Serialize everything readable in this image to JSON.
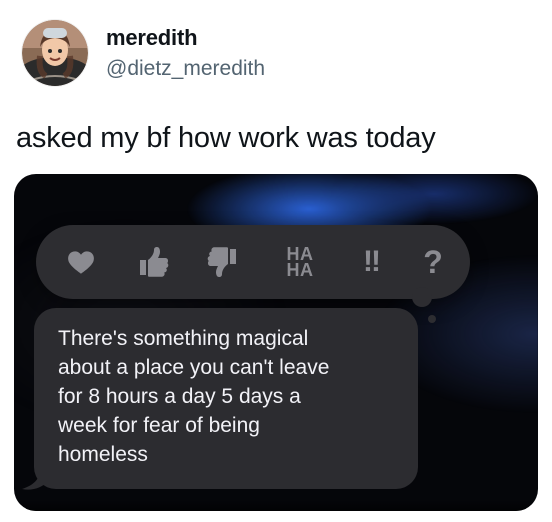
{
  "tweet": {
    "display_name": "meredith",
    "handle": "@dietz_meredith",
    "text": "asked my bf how work was today"
  },
  "screenshot": {
    "tapback_icons": [
      {
        "name": "heart-icon"
      },
      {
        "name": "thumbs-up-icon"
      },
      {
        "name": "thumbs-down-icon"
      },
      {
        "name": "haha-icon",
        "lines": [
          "HA",
          "HA"
        ]
      },
      {
        "name": "double-exclamation-icon",
        "label": "!!"
      },
      {
        "name": "question-icon",
        "label": "?"
      }
    ],
    "message": {
      "text": "There's something magical\nabout a place you can't leave\nfor 8 hours a day 5 days a\nweek for fear of being\nhomeless"
    }
  }
}
